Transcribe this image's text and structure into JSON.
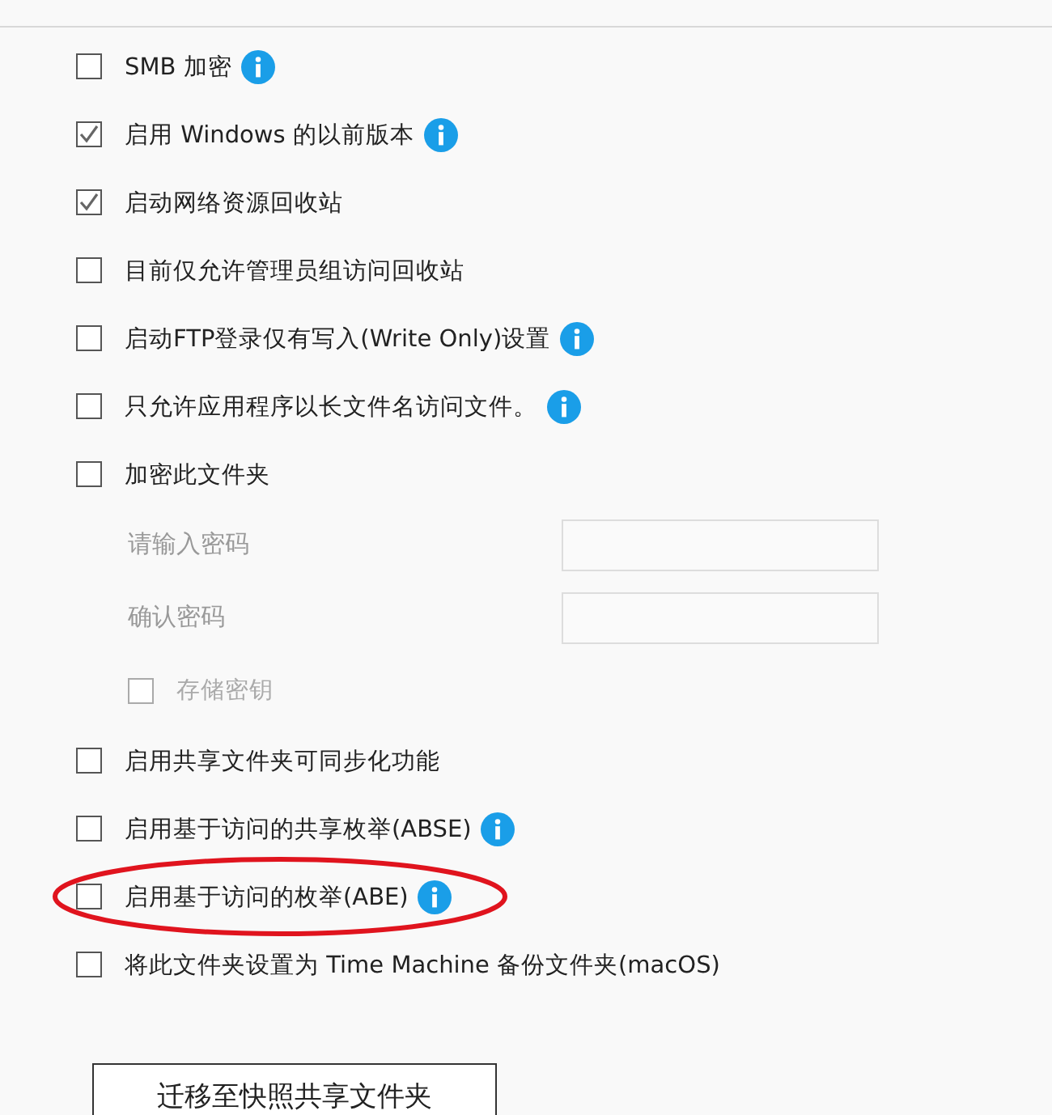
{
  "options": [
    {
      "kind": "checkbox",
      "label": "SMB 加密",
      "checked": false,
      "info": true
    },
    {
      "kind": "checkbox",
      "label": "启用 Windows 的以前版本",
      "checked": true,
      "info": true
    },
    {
      "kind": "checkbox",
      "label": "启动网络资源回收站",
      "checked": true
    },
    {
      "kind": "checkbox",
      "label": "目前仅允许管理员组访问回收站",
      "checked": false
    },
    {
      "kind": "checkbox",
      "label": "启动FTP登录仅有写入(Write Only)设置",
      "checked": false,
      "info": true
    },
    {
      "kind": "checkbox",
      "label": "只允许应用程序以长文件名访问文件。",
      "checked": false,
      "info": true
    },
    {
      "kind": "checkbox",
      "label": "加密此文件夹",
      "checked": false
    },
    {
      "kind": "password",
      "fields": [
        {
          "label": "请输入密码"
        },
        {
          "label": "确认密码"
        }
      ],
      "store_key": {
        "label": "存储密钥",
        "checked": false,
        "disabled": true
      }
    },
    {
      "kind": "checkbox",
      "label": "启用共享文件夹可同步化功能",
      "checked": false
    },
    {
      "kind": "checkbox",
      "label": "启用基于访问的共享枚举(ABSE)",
      "checked": false,
      "info": true
    },
    {
      "kind": "checkbox",
      "label": "启用基于访问的枚举(ABE)",
      "checked": false,
      "info": true,
      "circled": true
    },
    {
      "kind": "checkbox",
      "label": "将此文件夹设置为 Time Machine 备份文件夹(macOS)",
      "checked": false
    }
  ],
  "button": {
    "label": "迁移至快照共享文件夹"
  }
}
